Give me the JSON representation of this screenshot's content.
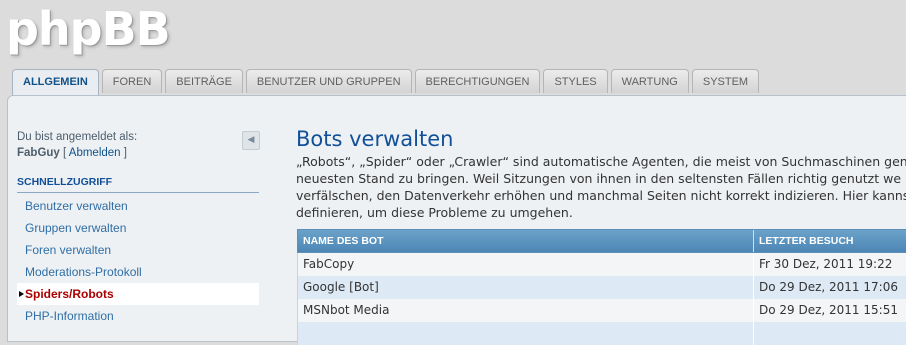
{
  "logo": {
    "text": "phpBB"
  },
  "tabs": [
    {
      "label": "ALLGEMEIN",
      "active": true
    },
    {
      "label": "FOREN"
    },
    {
      "label": "BEITRÄGE"
    },
    {
      "label": "BENUTZER UND GRUPPEN"
    },
    {
      "label": "BERECHTIGUNGEN"
    },
    {
      "label": "STYLES"
    },
    {
      "label": "WARTUNG"
    },
    {
      "label": "SYSTEM"
    }
  ],
  "sidebar": {
    "logged_in_label": "Du bist angemeldet als:",
    "username": "FabGuy",
    "logout_open": "[ ",
    "logout_label": "Abmelden",
    "logout_close": " ]",
    "collapse_glyph": "◀",
    "quick_access_heading": "SCHNELLZUGRIFF",
    "items": [
      {
        "label": "Benutzer verwalten"
      },
      {
        "label": "Gruppen verwalten"
      },
      {
        "label": "Foren verwalten"
      },
      {
        "label": "Moderations-Protokoll"
      },
      {
        "label": "Spiders/Robots",
        "active": true
      },
      {
        "label": "PHP-Information"
      }
    ]
  },
  "main": {
    "title": "Bots verwalten",
    "description_lines": [
      "„Robots“, „Spider“ oder „Crawler“ sind automatische Agenten, die meist von Suchmaschinen gen",
      "neuesten Stand zu bringen. Weil Sitzungen von ihnen in den seltensten Fällen richtig genutzt we",
      "verfälschen, den Datenverkehr erhöhen und manchmal Seiten nicht korrekt indizieren. Hier kanns",
      "definieren, um diese Probleme zu umgehen."
    ],
    "table": {
      "headers": [
        "NAME DES BOT",
        "LETZTER BESUCH"
      ],
      "rows": [
        [
          "FabCopy",
          "Fr 30 Dez, 2011 19:22"
        ],
        [
          "Google [Bot]",
          "Do 29 Dez, 2011 17:06"
        ],
        [
          "MSNbot Media",
          "Do 29 Dez, 2011 15:51"
        ],
        [
          "",
          ""
        ]
      ]
    }
  },
  "colors": {
    "accent": "#105289",
    "active_menu": "#aa0000",
    "table_header": "#5a91bd"
  }
}
